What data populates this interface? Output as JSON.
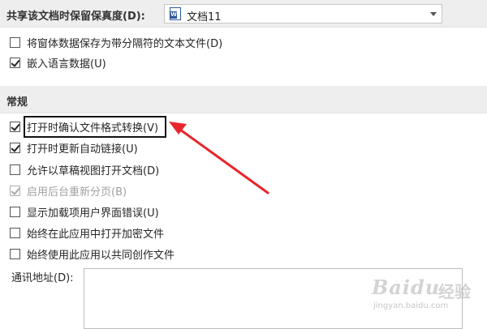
{
  "preserve": {
    "label": "共享该文档时保留保真度(D):",
    "document_name": "文档11",
    "document_icon": "word-document-icon"
  },
  "export_options": [
    {
      "label": "将窗体数据保存为带分隔符的文本文件(D)",
      "checked": false,
      "disabled": false
    },
    {
      "label": "嵌入语言数据(U)",
      "checked": true,
      "disabled": false
    }
  ],
  "general": {
    "title": "常规",
    "options": [
      {
        "label": "打开时确认文件格式转换(V)",
        "checked": true,
        "disabled": false,
        "highlighted": true
      },
      {
        "label": "打开时更新自动链接(U)",
        "checked": true,
        "disabled": false
      },
      {
        "label": "允许以草稿视图打开文档(D)",
        "checked": false,
        "disabled": false
      },
      {
        "label": "启用后台重新分页(B)",
        "checked": true,
        "disabled": true
      },
      {
        "label": "显示加载项用户界面错误(U)",
        "checked": false,
        "disabled": false
      },
      {
        "label": "始终在此应用中打开加密文件",
        "checked": false,
        "disabled": false
      },
      {
        "label": "始终使用此应用以共同创作文件",
        "checked": false,
        "disabled": false
      }
    ],
    "mailing_address_label": "通讯地址(D):",
    "mailing_address_value": ""
  },
  "annotation": {
    "arrow_color": "#e8262b",
    "box_color": "#111111"
  },
  "watermark": {
    "brand": "Baidu",
    "text": "经验",
    "url": "jingyan.baidu.com"
  }
}
